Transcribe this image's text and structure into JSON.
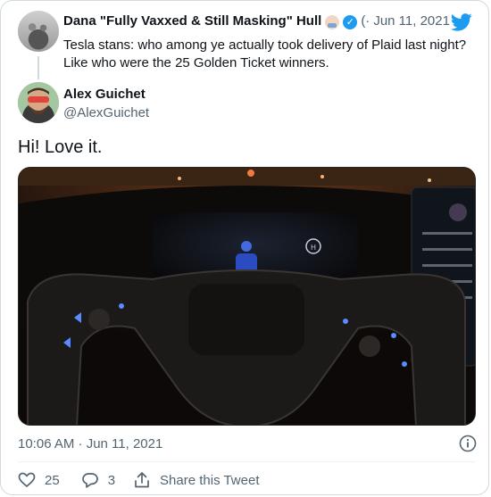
{
  "parent_tweet": {
    "author_name": "Dana \"Fully Vaxxed & Still Masking\" Hull",
    "emoji_icon": "woman-health-worker-icon",
    "verified_icon": "verified-badge-icon",
    "truncation": "(·",
    "separator": "·",
    "date": "Jun 11, 2021",
    "text": "Tesla stans: who among ye actually took delivery of Plaid last night? Like who were the 25 Golden Ticket winners."
  },
  "tweet": {
    "author_name": "Alex Guichet",
    "handle": "@AlexGuichet",
    "text": "Hi! Love it.",
    "media_alt": "Tesla Plaid yoke steering wheel and dashboard at night",
    "timestamp": "10:06 AM · Jun 11, 2021"
  },
  "actions": {
    "likes": "25",
    "replies": "3",
    "share_label": "Share this Tweet"
  },
  "colors": {
    "brand": "#1d9bf0",
    "muted": "#536471",
    "border": "#cfd9de"
  }
}
